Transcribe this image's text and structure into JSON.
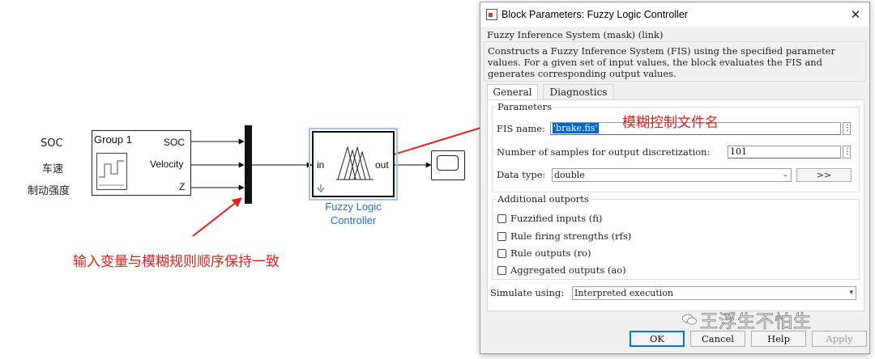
{
  "canvas": {
    "signals": [
      "SOC",
      "车速",
      "制动强度"
    ],
    "signal_builder": {
      "title": "Group 1",
      "outputs": [
        "SOC",
        "Velocity",
        "Z"
      ]
    },
    "fuzzy_block": {
      "in_port": "in",
      "out_port": "out",
      "caption_line1": "Fuzzy Logic",
      "caption_line2": "Controller"
    },
    "annotations": {
      "fis_name_note": "模糊控制文件名",
      "input_order_note": "输入变量与模糊规则顺序保持一致"
    },
    "colors": {
      "annotation": "#e2231a",
      "caption": "#2a6fd6",
      "selection": "#9cc8ee"
    }
  },
  "dialog": {
    "title": "Block Parameters: Fuzzy Logic Controller",
    "mask_title": "Fuzzy Inference System (mask) (link)",
    "description": "Constructs a Fuzzy Inference System (FIS) using the specified parameter values. For a given set of input values, the block evaluates the FIS and generates corresponding output values.",
    "tabs": [
      "General",
      "Diagnostics"
    ],
    "active_tab": "General",
    "parameters": {
      "group_title": "Parameters",
      "fis_name_label": "FIS name:",
      "fis_name_value": "'brake.fis'",
      "samples_label": "Number of samples for output discretization:",
      "samples_value": "101",
      "data_type_label": "Data type:",
      "data_type_value": "double",
      "data_type_button": ">>"
    },
    "additional_outports": {
      "group_title": "Additional outports",
      "options": [
        {
          "label": "Fuzzified inputs (fi)",
          "checked": false
        },
        {
          "label": "Rule firing strengths (rfs)",
          "checked": false
        },
        {
          "label": "Rule outputs (ro)",
          "checked": false
        },
        {
          "label": "Aggregated outputs (ao)",
          "checked": false
        }
      ]
    },
    "simulate_label": "Simulate using:",
    "simulate_value": "Interpreted execution",
    "buttons": {
      "ok": "OK",
      "cancel": "Cancel",
      "help": "Help",
      "apply": "Apply"
    }
  },
  "watermark": "王浮生不怕生"
}
